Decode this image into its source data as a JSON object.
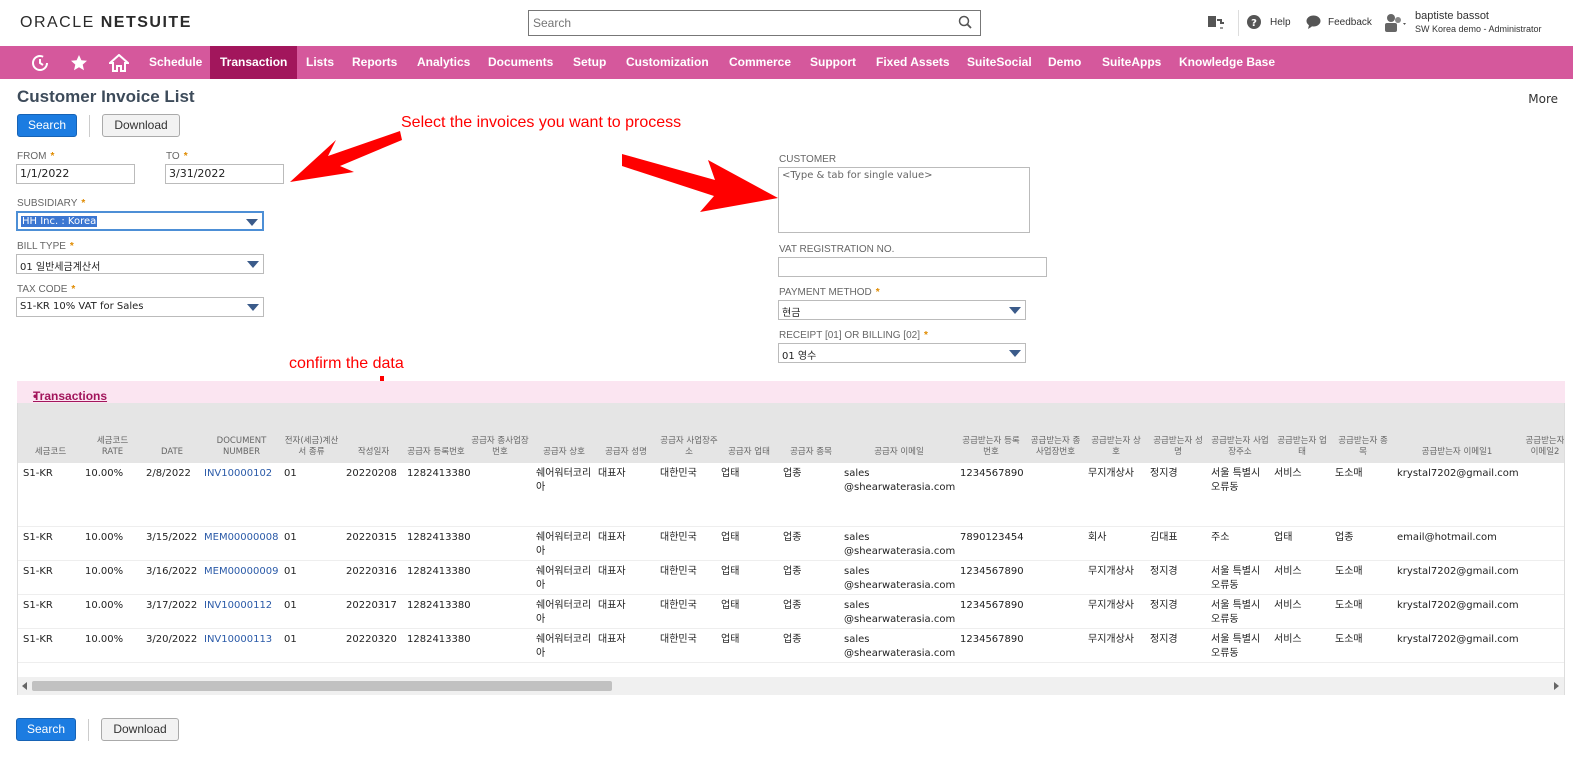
{
  "brand": {
    "oracle": "ORACLE",
    "netsuite": "NETSUITE"
  },
  "search": {
    "placeholder": "Search"
  },
  "topbar": {
    "help": "Help",
    "feedback": "Feedback",
    "user_name": "baptiste bassot",
    "user_role": "SW Korea demo - Administrator"
  },
  "nav": {
    "items": [
      "Schedule",
      "Transaction",
      "Lists",
      "Reports",
      "Analytics",
      "Documents",
      "Setup",
      "Customization",
      "Commerce",
      "Support",
      "Fixed Assets",
      "SuiteSocial",
      "Demo",
      "SuiteApps",
      "Knowledge Base"
    ],
    "active": "Transaction"
  },
  "page": {
    "title": "Customer Invoice List",
    "more": "More"
  },
  "buttons": {
    "search": "Search",
    "download": "Download"
  },
  "form": {
    "from_label": "FROM",
    "from_value": "1/1/2022",
    "to_label": "TO",
    "to_value": "3/31/2022",
    "subsidiary_label": "SUBSIDIARY",
    "subsidiary_value": "HH Inc. : Korea",
    "bill_type_label": "BILL TYPE",
    "bill_type_value": "01 일반세금계산서",
    "tax_code_label": "TAX CODE",
    "tax_code_value": "S1-KR 10% VAT for Sales",
    "customer_label": "CUSTOMER",
    "customer_placeholder": "<Type & tab for single value>",
    "vat_label": "VAT REGISTRATION NO.",
    "vat_value": "",
    "payment_label": "PAYMENT METHOD",
    "payment_value": "현금",
    "receipt_label": "RECEIPT [01] OR BILLING [02]",
    "receipt_value": "01 영수"
  },
  "annotations": {
    "select": "Select the invoices you want to process",
    "confirm": "confirm the data"
  },
  "transactions": {
    "title": "Transactions",
    "dot": "•",
    "columns": [
      "세금코드",
      "세금코드 RATE",
      "DATE",
      "DOCUMENT NUMBER",
      "전자(세금)계산서 종류",
      "작성일자",
      "공급자 등록번호",
      "공급자 종사업장 번호",
      "공급자 상호",
      "공급자 성명",
      "공급자 사업장주소",
      "공급자 업태",
      "공급자 종목",
      "공급자 이메일",
      "공급받는자 등록번호",
      "공급받는자 종사업장번호",
      "공급받는자 상호",
      "공급받는자 성명",
      "공급받는자 사업장주소",
      "공급받는자 업태",
      "공급받는자 종목",
      "공급받는자 이메일1",
      "공급받는자 이메일2"
    ],
    "rows": [
      [
        "S1-KR",
        "10.00%",
        "2/8/2022",
        "INV10000102",
        "01",
        "20220208",
        "1282413380",
        "",
        "쉐어워터코리아",
        "대표자",
        "대한민국",
        "업태",
        "업종",
        "sales @shearwaterasia.com",
        "1234567890",
        "",
        "무지개상사",
        "정지경",
        "서울 특별시 오류동",
        "서비스",
        "도소매",
        "krystal7202@gmail.com",
        ""
      ],
      [
        "S1-KR",
        "10.00%",
        "3/15/2022",
        "MEM00000008",
        "01",
        "20220315",
        "1282413380",
        "",
        "쉐어워터코리아",
        "대표자",
        "대한민국",
        "업태",
        "업종",
        "sales @shearwaterasia.com",
        "7890123454",
        "",
        "회사",
        "김대표",
        "주소",
        "업태",
        "업종",
        "email@hotmail.com",
        ""
      ],
      [
        "S1-KR",
        "10.00%",
        "3/16/2022",
        "MEM00000009",
        "01",
        "20220316",
        "1282413380",
        "",
        "쉐어워터코리아",
        "대표자",
        "대한민국",
        "업태",
        "업종",
        "sales @shearwaterasia.com",
        "1234567890",
        "",
        "무지개상사",
        "정지경",
        "서울 특별시 오류동",
        "서비스",
        "도소매",
        "krystal7202@gmail.com",
        ""
      ],
      [
        "S1-KR",
        "10.00%",
        "3/17/2022",
        "INV10000112",
        "01",
        "20220317",
        "1282413380",
        "",
        "쉐어워터코리아",
        "대표자",
        "대한민국",
        "업태",
        "업종",
        "sales @shearwaterasia.com",
        "1234567890",
        "",
        "무지개상사",
        "정지경",
        "서울 특별시 오류동",
        "서비스",
        "도소매",
        "krystal7202@gmail.com",
        ""
      ],
      [
        "S1-KR",
        "10.00%",
        "3/20/2022",
        "INV10000113",
        "01",
        "20220320",
        "1282413380",
        "",
        "쉐어워터코리아",
        "대표자",
        "대한민국",
        "업태",
        "업종",
        "sales @shearwaterasia.com",
        "1234567890",
        "",
        "무지개상사",
        "정지경",
        "서울 특별시 오류동",
        "서비스",
        "도소매",
        "krystal7202@gmail.com",
        ""
      ]
    ]
  },
  "colors": {
    "nav_bg": "#d5589c",
    "nav_active": "#a2165c",
    "primary": "#1c7ce1",
    "annotation": "#ff0000"
  }
}
